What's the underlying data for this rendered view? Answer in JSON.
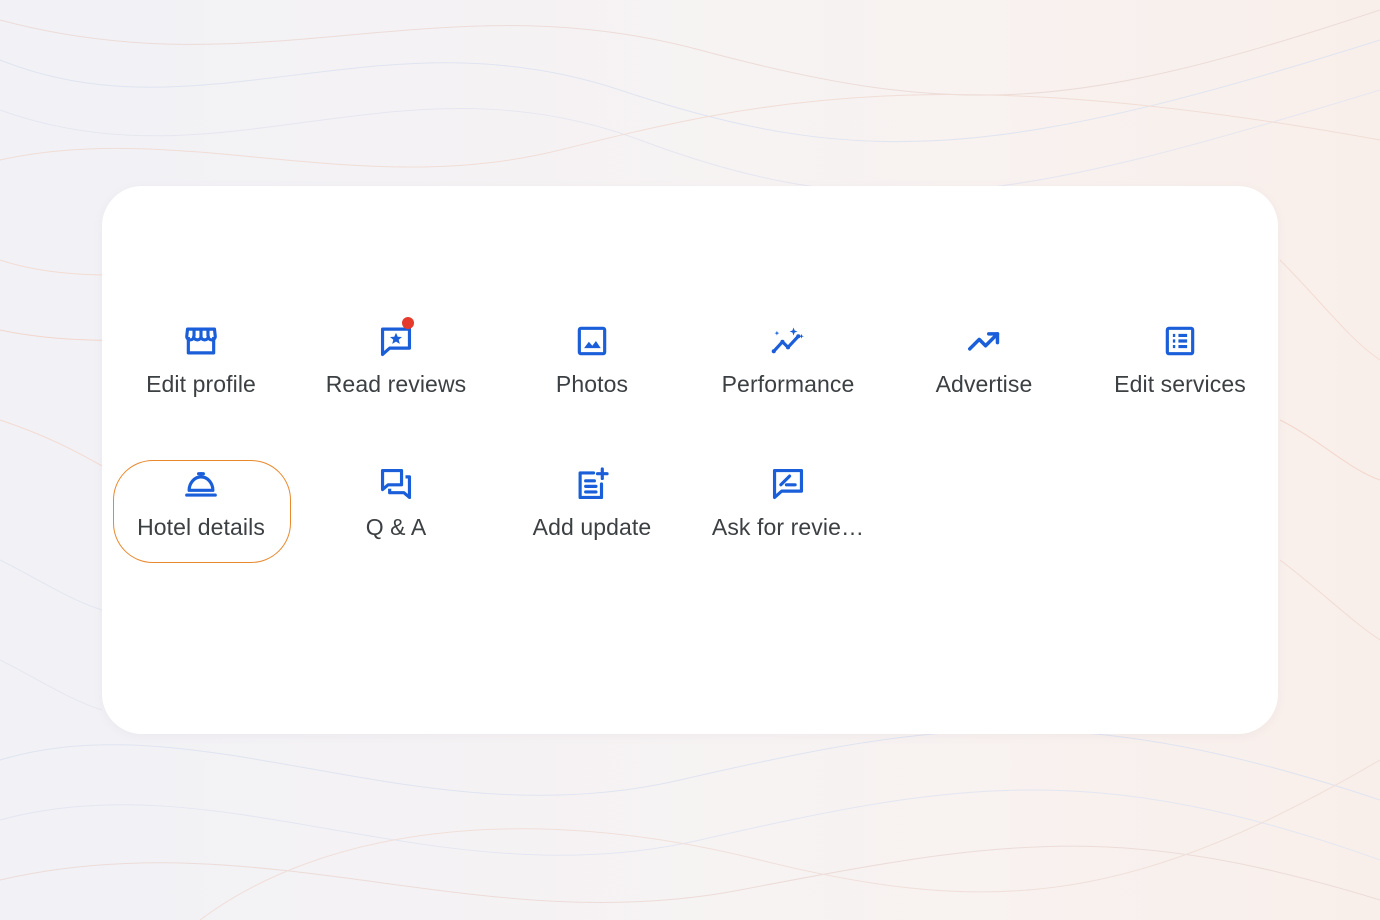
{
  "colors": {
    "accent": "#1a5fd9",
    "label": "#3c4043",
    "notification_dot": "#e53a2c",
    "highlight_ring": "#e8892e",
    "card": "#ffffff"
  },
  "actions_row1": [
    {
      "label": "Edit profile",
      "icon": "storefront-icon"
    },
    {
      "label": "Read reviews",
      "icon": "review-star-icon",
      "has_notification": true
    },
    {
      "label": "Photos",
      "icon": "photo-icon"
    },
    {
      "label": "Performance",
      "icon": "performance-sparkle-icon"
    },
    {
      "label": "Advertise",
      "icon": "trending-up-icon"
    },
    {
      "label": "Edit services",
      "icon": "list-icon"
    }
  ],
  "actions_row2": [
    {
      "label": "Hotel details",
      "icon": "room-service-bell-icon",
      "highlighted": true
    },
    {
      "label": "Q & A",
      "icon": "forum-icon"
    },
    {
      "label": "Add update",
      "icon": "post-add-icon"
    },
    {
      "label": "Ask for revie…",
      "icon": "rate-review-icon"
    }
  ]
}
